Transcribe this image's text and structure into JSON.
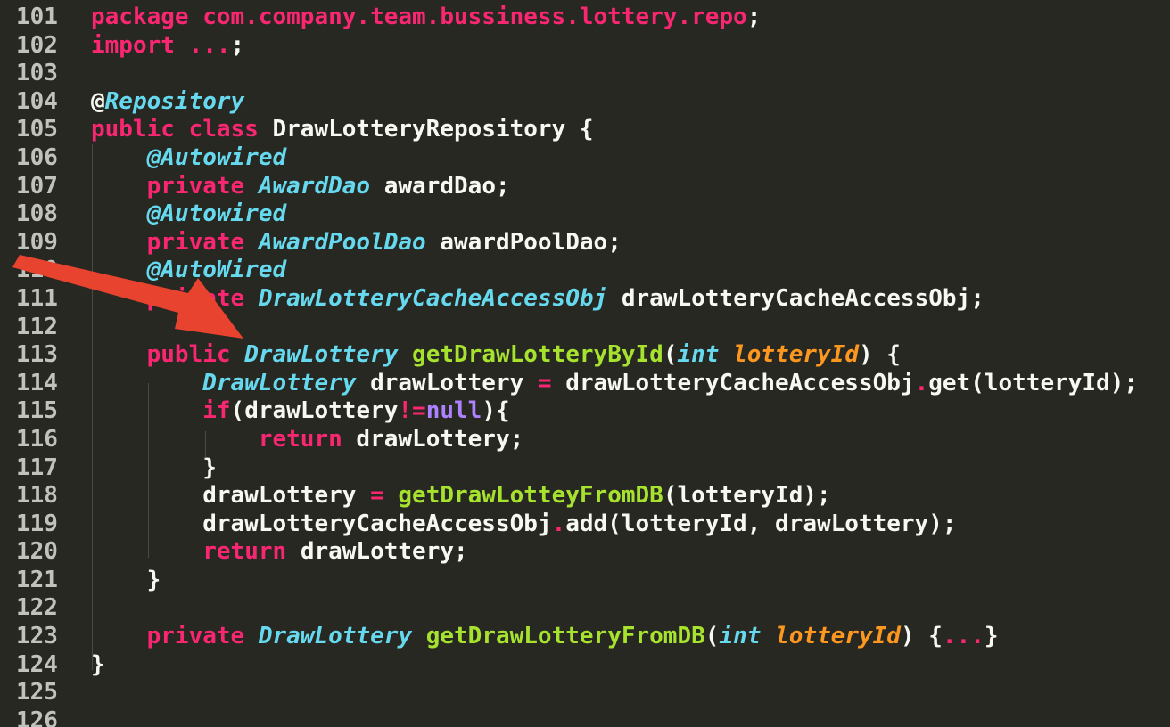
{
  "editor": {
    "lines": [
      {
        "number": "101",
        "tokens": [
          {
            "text": "package com.company.team.bussiness.lottery.repo",
            "cls": "kw"
          },
          {
            "text": ";",
            "cls": "plain"
          }
        ]
      },
      {
        "number": "102",
        "tokens": [
          {
            "text": "import ...",
            "cls": "kw"
          },
          {
            "text": ";",
            "cls": "plain"
          }
        ]
      },
      {
        "number": "103",
        "tokens": []
      },
      {
        "number": "104",
        "tokens": [
          {
            "text": "@",
            "cls": "plain"
          },
          {
            "text": "Repository",
            "cls": "typ"
          }
        ]
      },
      {
        "number": "105",
        "tokens": [
          {
            "text": "public class ",
            "cls": "kw"
          },
          {
            "text": "DrawLotteryRepository {",
            "cls": "plain"
          }
        ]
      },
      {
        "number": "106",
        "tokens": [
          {
            "text": "    ",
            "cls": "plain"
          },
          {
            "text": "@Autowired",
            "cls": "typ"
          }
        ]
      },
      {
        "number": "107",
        "tokens": [
          {
            "text": "    ",
            "cls": "plain"
          },
          {
            "text": "private ",
            "cls": "kw"
          },
          {
            "text": "AwardDao",
            "cls": "typ"
          },
          {
            "text": " awardDao;",
            "cls": "plain"
          }
        ]
      },
      {
        "number": "108",
        "tokens": [
          {
            "text": "    ",
            "cls": "plain"
          },
          {
            "text": "@Autowired",
            "cls": "typ"
          }
        ]
      },
      {
        "number": "109",
        "tokens": [
          {
            "text": "    ",
            "cls": "plain"
          },
          {
            "text": "private ",
            "cls": "kw"
          },
          {
            "text": "AwardPoolDao",
            "cls": "typ"
          },
          {
            "text": " awardPoolDao;",
            "cls": "plain"
          }
        ]
      },
      {
        "number": "110",
        "tokens": [
          {
            "text": "    ",
            "cls": "plain"
          },
          {
            "text": "@AutoWired",
            "cls": "typ"
          }
        ]
      },
      {
        "number": "111",
        "tokens": [
          {
            "text": "    ",
            "cls": "plain"
          },
          {
            "text": "private ",
            "cls": "kw"
          },
          {
            "text": "DrawLotteryCacheAccessObj",
            "cls": "typ"
          },
          {
            "text": " drawLotteryCacheAccessObj;",
            "cls": "plain"
          }
        ]
      },
      {
        "number": "112",
        "tokens": []
      },
      {
        "number": "113",
        "tokens": [
          {
            "text": "    ",
            "cls": "plain"
          },
          {
            "text": "public ",
            "cls": "kw"
          },
          {
            "text": "DrawLottery",
            "cls": "typ"
          },
          {
            "text": " ",
            "cls": "plain"
          },
          {
            "text": "getDrawLotteryById",
            "cls": "fn"
          },
          {
            "text": "(",
            "cls": "plain"
          },
          {
            "text": "int",
            "cls": "typ"
          },
          {
            "text": " ",
            "cls": "plain"
          },
          {
            "text": "lotteryId",
            "cls": "param"
          },
          {
            "text": ") {",
            "cls": "plain"
          }
        ]
      },
      {
        "number": "114",
        "tokens": [
          {
            "text": "        ",
            "cls": "plain"
          },
          {
            "text": "DrawLottery",
            "cls": "typ"
          },
          {
            "text": " drawLottery ",
            "cls": "plain"
          },
          {
            "text": "=",
            "cls": "kw"
          },
          {
            "text": " drawLotteryCacheAccessObj",
            "cls": "plain"
          },
          {
            "text": ".",
            "cls": "kw"
          },
          {
            "text": "get(lotteryId);",
            "cls": "plain"
          }
        ]
      },
      {
        "number": "115",
        "tokens": [
          {
            "text": "        ",
            "cls": "plain"
          },
          {
            "text": "if",
            "cls": "kw"
          },
          {
            "text": "(drawLottery",
            "cls": "plain"
          },
          {
            "text": "!=",
            "cls": "kw"
          },
          {
            "text": "null",
            "cls": "const"
          },
          {
            "text": "){",
            "cls": "plain"
          }
        ]
      },
      {
        "number": "116",
        "tokens": [
          {
            "text": "            ",
            "cls": "plain"
          },
          {
            "text": "return ",
            "cls": "kw"
          },
          {
            "text": "drawLottery;",
            "cls": "plain"
          }
        ]
      },
      {
        "number": "117",
        "tokens": [
          {
            "text": "        }",
            "cls": "plain"
          }
        ]
      },
      {
        "number": "118",
        "tokens": [
          {
            "text": "        drawLottery ",
            "cls": "plain"
          },
          {
            "text": "=",
            "cls": "kw"
          },
          {
            "text": " ",
            "cls": "plain"
          },
          {
            "text": "getDrawLotteyFromDB",
            "cls": "fn"
          },
          {
            "text": "(lotteryId);",
            "cls": "plain"
          }
        ]
      },
      {
        "number": "119",
        "tokens": [
          {
            "text": "        drawLotteryCacheAccessObj",
            "cls": "plain"
          },
          {
            "text": ".",
            "cls": "kw"
          },
          {
            "text": "add(lotteryId, drawLottery);",
            "cls": "plain"
          }
        ]
      },
      {
        "number": "120",
        "tokens": [
          {
            "text": "        ",
            "cls": "plain"
          },
          {
            "text": "return ",
            "cls": "kw"
          },
          {
            "text": "drawLottery;",
            "cls": "plain"
          }
        ]
      },
      {
        "number": "121",
        "tokens": [
          {
            "text": "    }",
            "cls": "plain"
          }
        ]
      },
      {
        "number": "122",
        "tokens": []
      },
      {
        "number": "123",
        "tokens": [
          {
            "text": "    ",
            "cls": "plain"
          },
          {
            "text": "private ",
            "cls": "kw"
          },
          {
            "text": "DrawLottery",
            "cls": "typ"
          },
          {
            "text": " ",
            "cls": "plain"
          },
          {
            "text": "getDrawLotteryFromDB",
            "cls": "fn"
          },
          {
            "text": "(",
            "cls": "plain"
          },
          {
            "text": "int",
            "cls": "typ"
          },
          {
            "text": " ",
            "cls": "plain"
          },
          {
            "text": "lotteryId",
            "cls": "param"
          },
          {
            "text": ") {",
            "cls": "plain"
          },
          {
            "text": "...",
            "cls": "kw"
          },
          {
            "text": "}",
            "cls": "plain"
          }
        ]
      },
      {
        "number": "124",
        "tokens": [
          {
            "text": "}",
            "cls": "plain"
          }
        ]
      },
      {
        "number": "125",
        "tokens": []
      },
      {
        "number": "126",
        "tokens": []
      }
    ]
  },
  "annotation": {
    "icon": "arrow-icon",
    "color": "#e8432f"
  },
  "theme": {
    "background": "#272822",
    "keyword": "#f92672",
    "type": "#66d9ef",
    "function": "#a6e22e",
    "parameter": "#fd971f",
    "constant": "#ae81ff",
    "text": "#f8f8f2",
    "line_number": "#c2c2bd"
  }
}
